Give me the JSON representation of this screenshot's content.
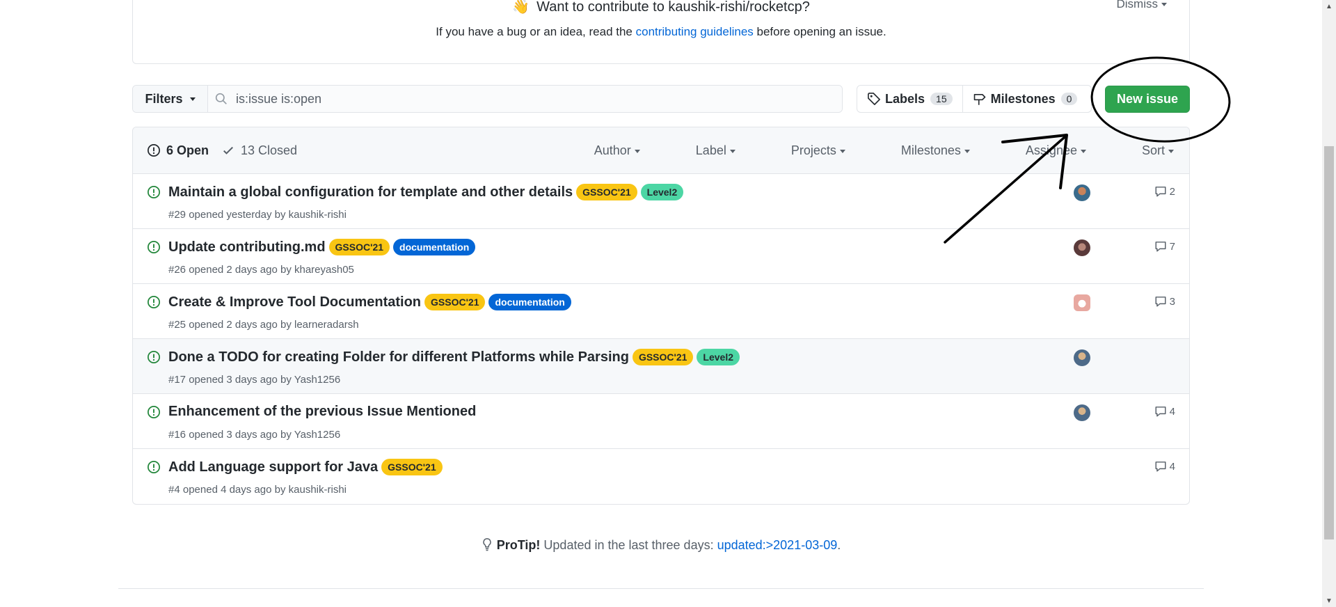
{
  "banner": {
    "title": "Want to contribute to kaushik-rishi/rocketcp?",
    "sub_before": "If you have a bug or an idea, read the ",
    "sub_link": "contributing guidelines",
    "sub_after": " before opening an issue.",
    "dismiss": "Dismiss"
  },
  "toolbar": {
    "filters_label": "Filters",
    "search_value": "is:issue is:open",
    "labels_label": "Labels",
    "labels_count": "15",
    "milestones_label": "Milestones",
    "milestones_count": "0",
    "new_issue_label": "New issue"
  },
  "header": {
    "open_label": "6 Open",
    "closed_label": "13 Closed",
    "filters": [
      "Author",
      "Label",
      "Projects",
      "Milestones",
      "Assignee",
      "Sort"
    ]
  },
  "issues": [
    {
      "title": "Maintain a global configuration for template and other details",
      "labels": [
        "GSSOC'21",
        "Level2"
      ],
      "meta": "#29 opened yesterday by kaushik-rishi",
      "comments": "2"
    },
    {
      "title": "Update contributing.md",
      "labels": [
        "GSSOC'21",
        "documentation"
      ],
      "meta": "#26 opened 2 days ago by khareyash05",
      "comments": "7"
    },
    {
      "title": "Create & Improve Tool Documentation",
      "labels": [
        "GSSOC'21",
        "documentation"
      ],
      "meta": "#25 opened 2 days ago by learneradarsh",
      "comments": "3"
    },
    {
      "title": "Done a TODO for creating Folder for different Platforms while Parsing",
      "labels": [
        "GSSOC'21",
        "Level2"
      ],
      "meta": "#17 opened 3 days ago by Yash1256",
      "comments": ""
    },
    {
      "title": "Enhancement of the previous Issue Mentioned",
      "labels": [],
      "meta": "#16 opened 3 days ago by Yash1256",
      "comments": "4"
    },
    {
      "title": "Add Language support for Java",
      "labels": [
        "GSSOC'21"
      ],
      "meta": "#4 opened 4 days ago by kaushik-rishi",
      "comments": "4"
    }
  ],
  "protip": {
    "bold": "ProTip!",
    "text": " Updated in the last three days: ",
    "link": "updated:>2021-03-09",
    "end": "."
  },
  "colors": {
    "green": "#2ea44f",
    "gssoc": "#f9c513",
    "level2": "#4cd6a4",
    "documentation": "#0366d6"
  }
}
